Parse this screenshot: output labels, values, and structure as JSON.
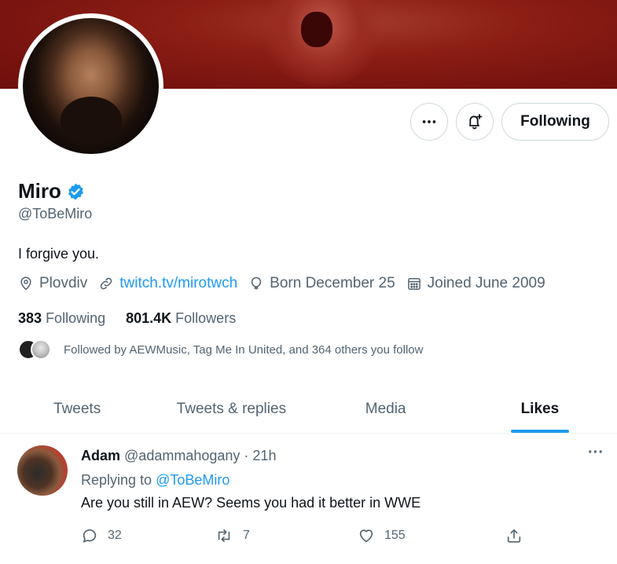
{
  "profile": {
    "name": "Miro",
    "handle": "@ToBeMiro",
    "bio": "I forgive you.",
    "location": "Plovdiv",
    "website": "twitch.tv/mirotwch",
    "birthday": "Born December 25",
    "joined": "Joined June 2009",
    "following_count": "383",
    "following_label": "Following",
    "followers_count": "801.4K",
    "followers_label": "Followers",
    "followed_by": "Followed by AEWMusic, Tag Me In United, and 364 others you follow",
    "follow_button_label": "Following",
    "more_icon": "more-horizontal-icon",
    "notify_icon": "bell-plus-icon",
    "verified_icon": "verified-badge-icon"
  },
  "tabs": [
    {
      "label": "Tweets",
      "active": false
    },
    {
      "label": "Tweets & replies",
      "active": false
    },
    {
      "label": "Media",
      "active": false
    },
    {
      "label": "Likes",
      "active": true
    }
  ],
  "tweet": {
    "author_name": "Adam",
    "author_handle": "@adammahogany",
    "time": "21h",
    "separator": "·",
    "replying_prefix": "Replying to",
    "replying_to": "@ToBeMiro",
    "text": "Are you still in AEW? Seems you had it better in WWE",
    "reply_count": "32",
    "retweet_count": "7",
    "like_count": "155",
    "more_label": "···"
  },
  "colors": {
    "accent": "#1d9bf0",
    "banner": "#8c1e14",
    "text_primary": "#0f1419",
    "text_secondary": "#536471"
  }
}
